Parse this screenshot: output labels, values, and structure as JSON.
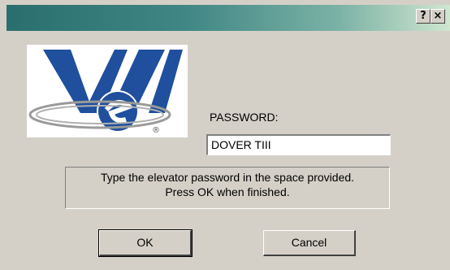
{
  "titlebar": {
    "help_label": "?",
    "close_label": "×"
  },
  "logo": {
    "name": "W/e logo",
    "colors": {
      "blue": "#1f4f9d",
      "grey": "#9a9a9a"
    },
    "registered_mark": "®"
  },
  "password": {
    "label": "PASSWORD:",
    "value": "DOVER TIII"
  },
  "info": {
    "line1": "Type the elevator password in the space provided.",
    "line2": "Press OK when finished."
  },
  "buttons": {
    "ok_label": "OK",
    "cancel_label": "Cancel"
  }
}
